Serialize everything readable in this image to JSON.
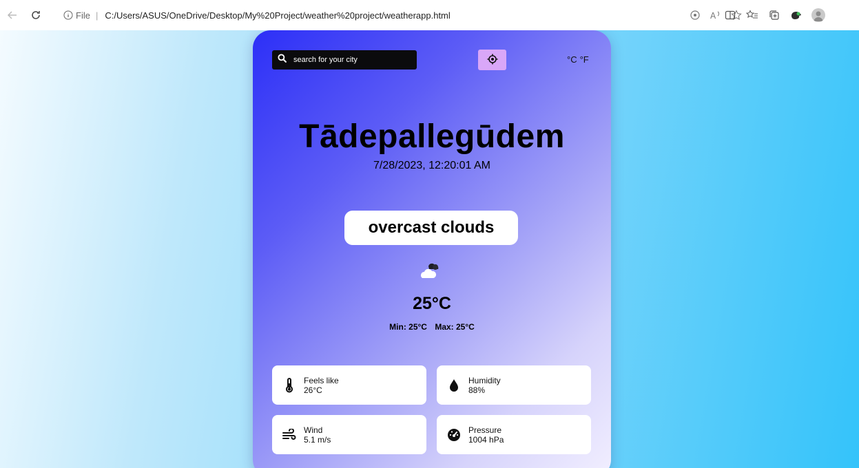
{
  "browser": {
    "scheme_label": "File",
    "separator": "|",
    "url": "C:/Users/ASUS/OneDrive/Desktop/My%20Project/weather%20project/weatherapp.html",
    "icons": [
      "back-icon",
      "reload-icon",
      "info-icon",
      "location-permission-icon",
      "read-aloud-icon",
      "favorite-star-icon",
      "split-screen-icon",
      "favorites-icon",
      "collections-icon",
      "extension-icon",
      "profile-avatar"
    ]
  },
  "weather": {
    "search_placeholder": "search for your city",
    "units": {
      "celsius": "°C",
      "fahrenheit": "°F"
    },
    "city": "Tādepallegūdem",
    "datetime": "7/28/2023, 12:20:01 AM",
    "condition": "overcast clouds",
    "condition_icon": "overcast-clouds-icon",
    "temperature": "25°C",
    "min": "Min: 25°C",
    "max": "Max: 25°C",
    "stats": {
      "feels_like": {
        "label": "Feels like",
        "value": "26°C",
        "icon": "thermometer-icon"
      },
      "humidity": {
        "label": "Humidity",
        "value": "88%",
        "icon": "droplet-icon"
      },
      "wind": {
        "label": "Wind",
        "value": "5.1 m/s",
        "icon": "wind-icon"
      },
      "pressure": {
        "label": "Pressure",
        "value": "1004 hPa",
        "icon": "gauge-icon"
      }
    }
  },
  "colors": {
    "card_gradient_start": "#2c2ff7",
    "card_gradient_end": "#f2efff",
    "search_bg": "#0b0b0d",
    "location_button_bg": "#d9a7f8",
    "page_bg_left": "#f4fbff",
    "page_bg_right": "#34c3fa"
  }
}
